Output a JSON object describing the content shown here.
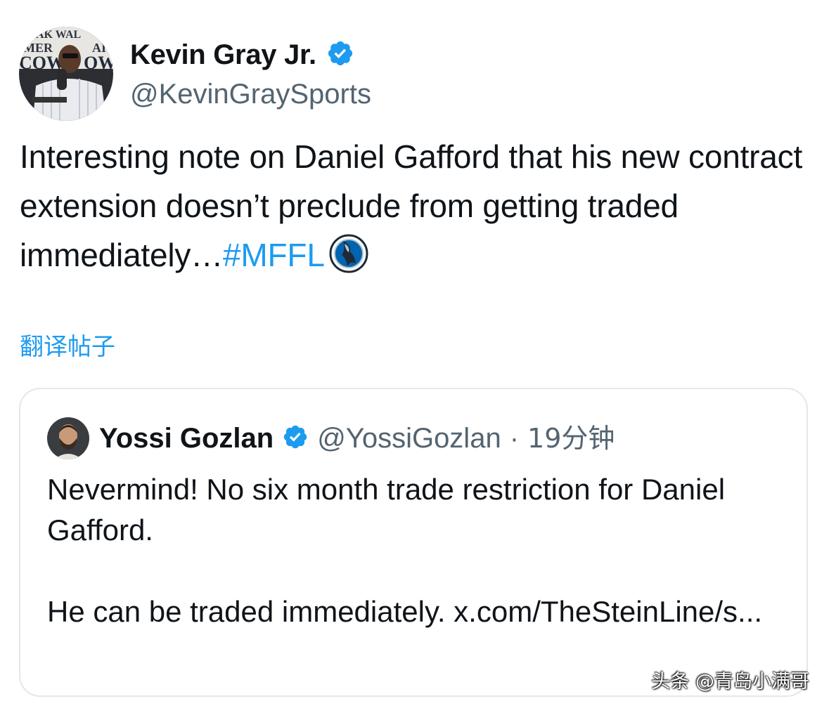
{
  "tweet": {
    "author": {
      "display_name": "Kevin Gray Jr.",
      "handle": "@KevinGraySports",
      "verified_icon": "verified-badge-icon",
      "avatar_sign_text": [
        "AK WAL",
        "MER",
        "AI",
        "COW",
        "OW"
      ]
    },
    "text_main": "Interesting note on Daniel Gafford that his new contract extension doesn’t preclude from getting traded immediately…",
    "hashtag": "#MFFL",
    "emoji": "mavericks-logo-icon",
    "translate_label": "翻译帖子"
  },
  "quoted_tweet": {
    "author": {
      "display_name": "Yossi Gozlan",
      "handle": "@YossiGozlan",
      "verified_icon": "verified-badge-icon"
    },
    "separator": "·",
    "time": "19分钟",
    "paragraph1": "Nevermind! No six month trade restriction for Daniel Gafford.",
    "paragraph2": "He can be traded immediately. x.com/TheSteinLine/s..."
  },
  "watermark": "头条 @青岛小满哥",
  "colors": {
    "text": "#0f1419",
    "secondary": "#536471",
    "accent": "#1d9bf0",
    "border": "#e1e8ed"
  }
}
